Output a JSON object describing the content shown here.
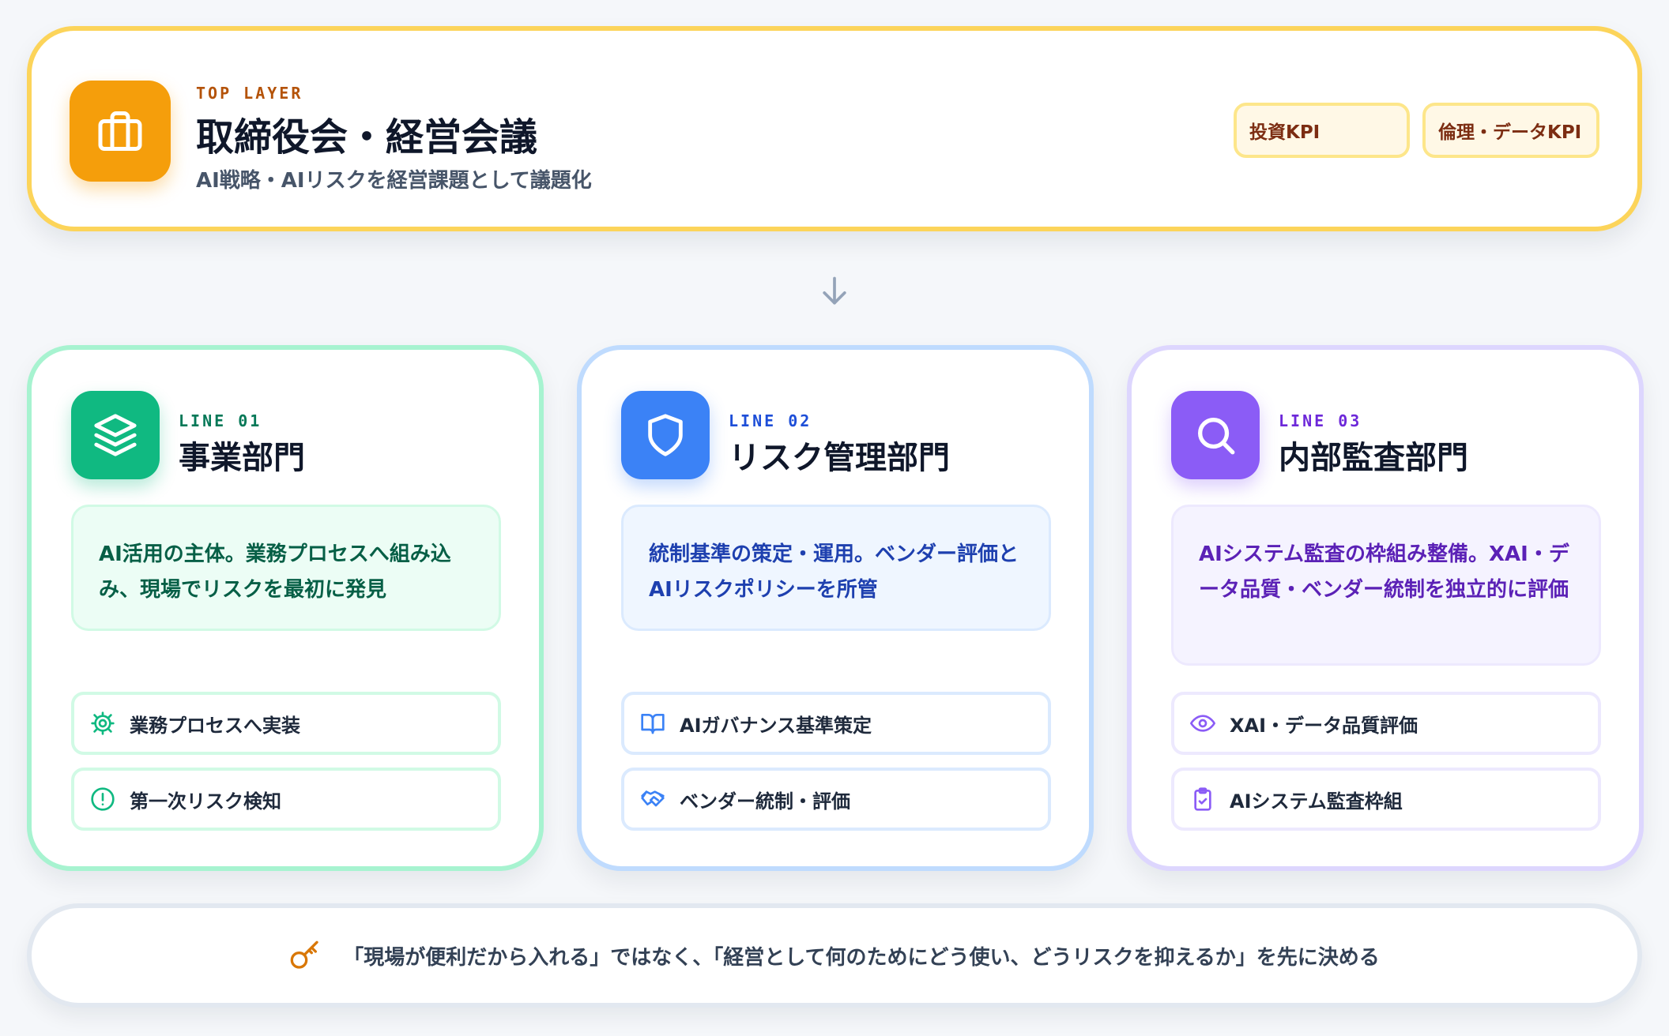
{
  "top": {
    "eyebrow": "TOP LAYER",
    "title": "取締役会・経営会議",
    "subtitle": "AI戦略・AIリスクを経営課題として議題化",
    "icon": "briefcase-icon",
    "kpis": [
      "投資KPI",
      "倫理・データKPI"
    ],
    "accent": "#f59e0b"
  },
  "lines": [
    {
      "eyebrow": "LINE 01",
      "title": "事業部門",
      "icon": "layers-icon",
      "accent": "#10b981",
      "description": "AI活用の主体。業務プロセスへ組み込み、現場でリスクを最初に発見",
      "items": [
        {
          "label": "業務プロセスへ実装",
          "icon": "gear-icon"
        },
        {
          "label": "第一次リスク検知",
          "icon": "alert-circle-icon"
        }
      ]
    },
    {
      "eyebrow": "LINE 02",
      "title": "リスク管理部門",
      "icon": "shield-icon",
      "accent": "#3b82f6",
      "description": "統制基準の策定・運用。ベンダー評価とAIリスクポリシーを所管",
      "items": [
        {
          "label": "AIガバナンス基準策定",
          "icon": "book-open-icon"
        },
        {
          "label": "ベンダー統制・評価",
          "icon": "handshake-icon"
        }
      ]
    },
    {
      "eyebrow": "LINE 03",
      "title": "内部監査部門",
      "icon": "search-icon",
      "accent": "#8b5cf6",
      "description": "AIシステム監査の枠組み整備。XAI・データ品質・ベンダー統制を独立的に評価",
      "items": [
        {
          "label": "XAI・データ品質評価",
          "icon": "eye-icon"
        },
        {
          "label": "AIシステム監査枠組",
          "icon": "clipboard-check-icon"
        }
      ]
    }
  ],
  "footer": {
    "icon": "key-icon",
    "text": "「現場が便利だから入れる」ではなく、「経営として何のためにどう使い、どうリスクを抑えるか」を先に決める"
  }
}
